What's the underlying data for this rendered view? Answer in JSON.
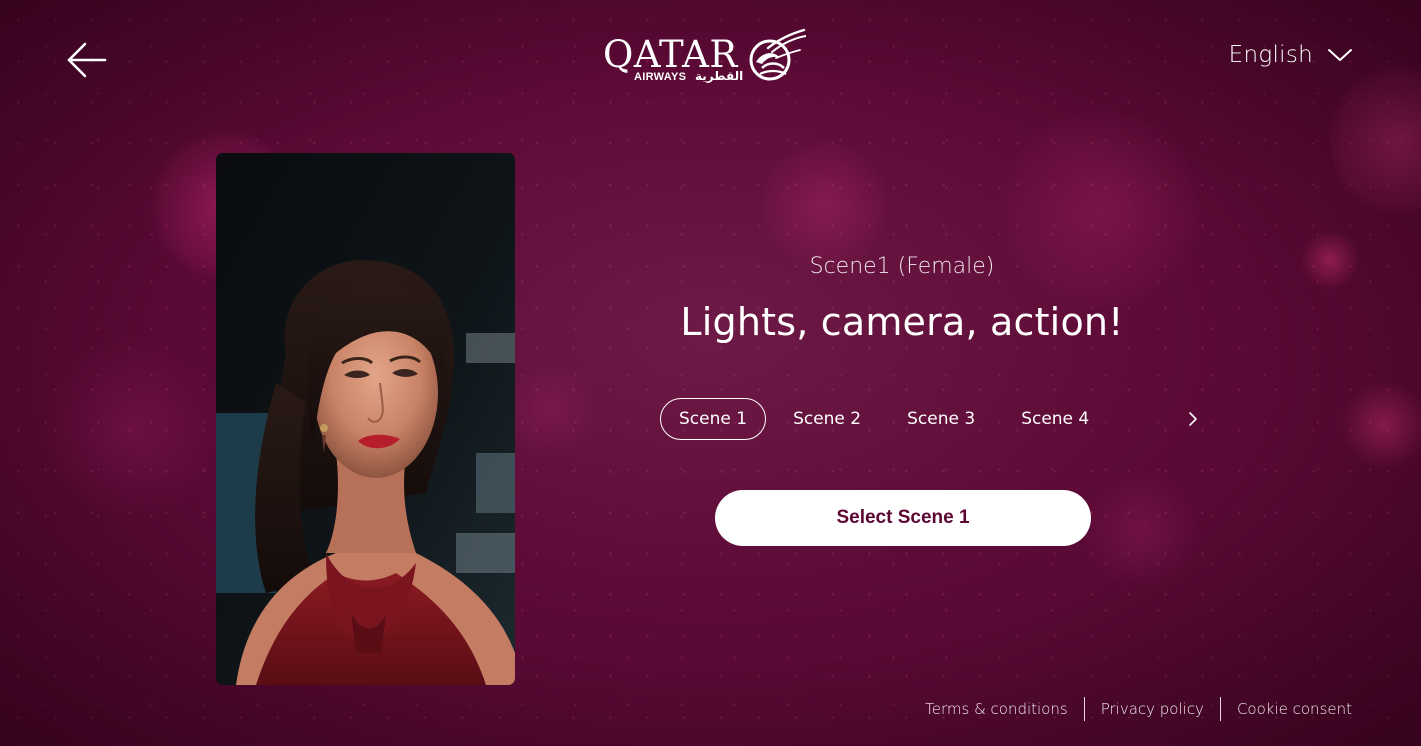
{
  "header": {
    "back_icon": "arrow-left-icon",
    "logo": {
      "wordmark": "QATAR",
      "sub": "AIRWAYS",
      "arabic": "القطرية",
      "emblem_icon": "oryx-icon"
    },
    "language": {
      "selected": "English",
      "icon": "chevron-down-icon"
    }
  },
  "preview": {
    "image": "scene-1-female-portrait"
  },
  "main": {
    "scene_subtitle": "Scene1 (Female)",
    "headline": "Lights, camera, action!",
    "tabs": [
      {
        "label": "Scene 1",
        "active": true
      },
      {
        "label": "Scene 2",
        "active": false
      },
      {
        "label": "Scene 3",
        "active": false
      },
      {
        "label": "Scene 4",
        "active": false
      }
    ],
    "next_icon": "chevron-right-icon",
    "select_button": "Select Scene 1"
  },
  "footer": {
    "links": [
      "Terms & conditions",
      "Privacy policy",
      "Cookie consent"
    ]
  },
  "colors": {
    "background": "#5d0a36",
    "button_text": "#5c0632",
    "button_bg": "#ffffff",
    "text": "#ffffff"
  }
}
